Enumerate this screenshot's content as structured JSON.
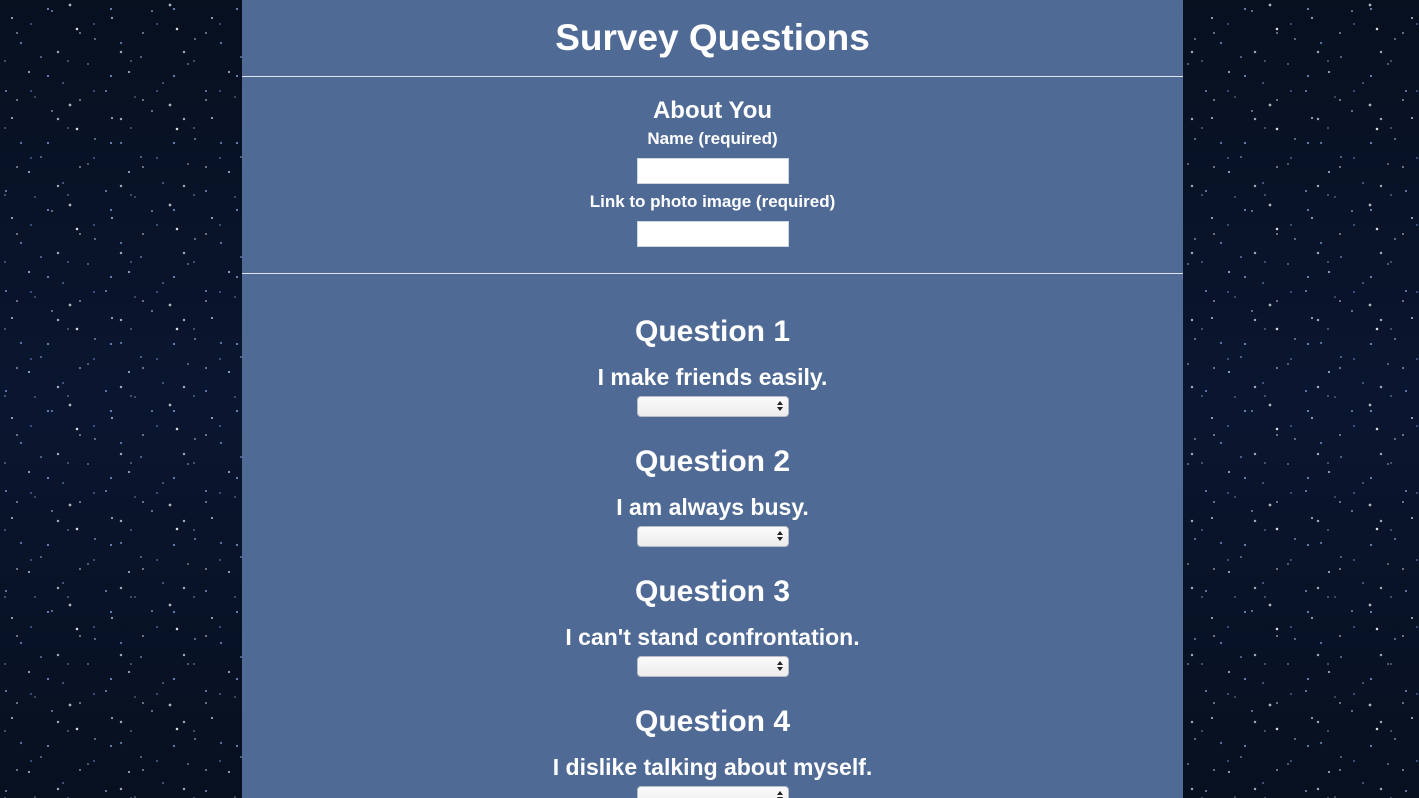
{
  "page": {
    "title": "Survey Questions"
  },
  "about": {
    "heading": "About You",
    "name_label": "Name (required)",
    "name_value": "",
    "photo_label": "Link to photo image (required)",
    "photo_value": ""
  },
  "questions": [
    {
      "heading": "Question 1",
      "text": "I make friends easily.",
      "selected": ""
    },
    {
      "heading": "Question 2",
      "text": "I am always busy.",
      "selected": ""
    },
    {
      "heading": "Question 3",
      "text": "I can't stand confrontation.",
      "selected": ""
    },
    {
      "heading": "Question 4",
      "text": "I dislike talking about myself.",
      "selected": ""
    }
  ],
  "colors": {
    "panel": "#506a96",
    "text": "#ffffff",
    "divider": "#dfe6f2"
  },
  "icons": {
    "select_arrow": "chevron-up-down-icon"
  }
}
